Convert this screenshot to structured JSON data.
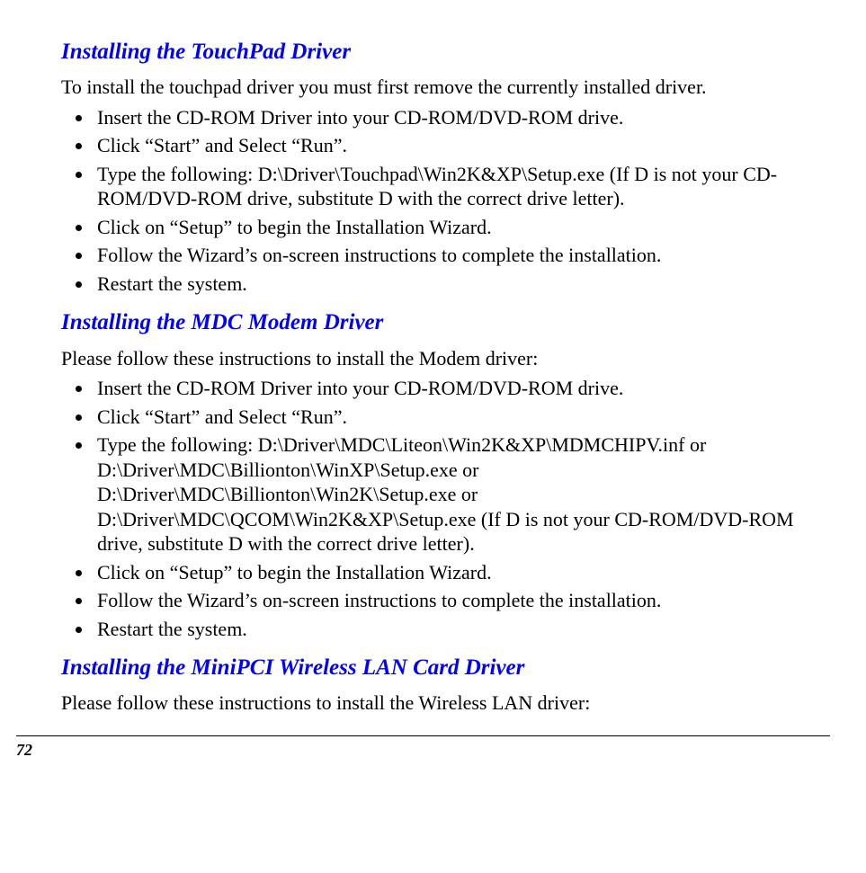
{
  "sections": [
    {
      "heading": "Installing the TouchPad Driver",
      "intro": "To install the touchpad driver you must first remove the currently installed driver.",
      "items": [
        "Insert the CD-ROM Driver into your CD-ROM/DVD-ROM drive.",
        "Click “Start” and Select “Run”.",
        "Type the following: D:\\Driver\\Touchpad\\Win2K&XP\\Setup.exe (If D is not your CD-ROM/DVD-ROM drive, substitute D with the correct drive letter).",
        "Click on “Setup” to begin the Installation Wizard.",
        "Follow the Wizard’s on-screen instructions to complete the installation.",
        "Restart the system."
      ]
    },
    {
      "heading": "Installing the MDC Modem Driver",
      "intro": "Please follow these instructions to install the Modem driver:",
      "items": [
        "Insert the CD-ROM Driver into your CD-ROM/DVD-ROM drive.",
        "Click “Start” and Select “Run”.",
        "Type the following: D:\\Driver\\MDC\\Liteon\\Win2K&XP\\MDMCHIPV.inf or D:\\Driver\\MDC\\Billionton\\WinXP\\Setup.exe or D:\\Driver\\MDC\\Billionton\\Win2K\\Setup.exe or D:\\Driver\\MDC\\QCOM\\Win2K&XP\\Setup.exe (If D is not your CD-ROM/DVD-ROM drive, substitute D with the correct drive letter).",
        "Click on “Setup” to begin the Installation Wizard.",
        "Follow the Wizard’s on-screen instructions to complete the installation.",
        "Restart the system."
      ]
    },
    {
      "heading": "Installing the MiniPCI Wireless LAN Card Driver",
      "intro": "Please follow these instructions to install the Wireless LAN driver:",
      "items": []
    }
  ],
  "page_number": "72"
}
